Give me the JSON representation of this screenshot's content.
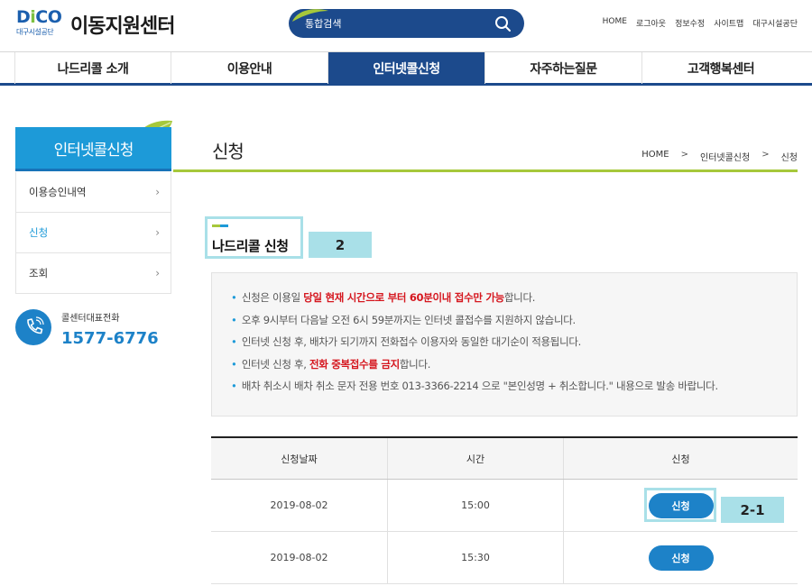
{
  "header": {
    "logo_text": "DiCO",
    "logo_sub": "대구시설공단",
    "site_title": "이동지원센터",
    "search_placeholder": "통합검색",
    "util_links": [
      "HOME",
      "로그아웃",
      "정보수정",
      "사이트맵",
      "대구시설공단"
    ]
  },
  "gnb": {
    "items": [
      "나드리콜 소개",
      "이용안내",
      "인터넷콜신청",
      "자주하는질문",
      "고객행복센터"
    ],
    "active_index": 2
  },
  "lnb": {
    "title": "인터넷콜신청",
    "items": [
      "이용승인내역",
      "신청",
      "조회"
    ],
    "active_index": 1
  },
  "call_center": {
    "label": "콜센터대표전화",
    "number": "1577-6776"
  },
  "page": {
    "title": "신청",
    "breadcrumb": [
      "HOME",
      "인터넷콜신청",
      "신청"
    ]
  },
  "section": {
    "title": "나드리콜 신청",
    "tag": "2",
    "row_tag": "2-1"
  },
  "notice": {
    "line1_pre": "신청은 이용일 ",
    "line1_red": "당일 현재 시간으로 부터 60분이내 접수만 가능",
    "line1_post": "합니다.",
    "line2": "오후 9시부터 다음날 오전 6시 59분까지는 인터넷 콜접수를 지원하지 않습니다.",
    "line3": "인터넷 신청 후, 배차가 되기까지 전화접수 이용자와 동일한 대기순이 적용됩니다.",
    "line4_pre": "인터넷 신청 후, ",
    "line4_red": "전화 중복접수를 금지",
    "line4_post": "합니다.",
    "line5": "배차 취소시 배차 취소 문자 전용 번호 013-3366-2214 으로 \"본인성명 + 취소합니다.\" 내용으로 발송 바랍니다."
  },
  "table": {
    "headers": [
      "신청날짜",
      "시간",
      "신청"
    ],
    "rows": [
      {
        "date": "2019-08-02",
        "time": "15:00",
        "button": "신청"
      },
      {
        "date": "2019-08-02",
        "time": "15:30",
        "button": "신청"
      }
    ]
  },
  "colors": {
    "navy": "#1c4a8c",
    "blue": "#1d82c8",
    "sky": "#1d9ad8",
    "green": "#a6c83b",
    "highlight": "#a9e0e8",
    "red": "#d5161e"
  }
}
